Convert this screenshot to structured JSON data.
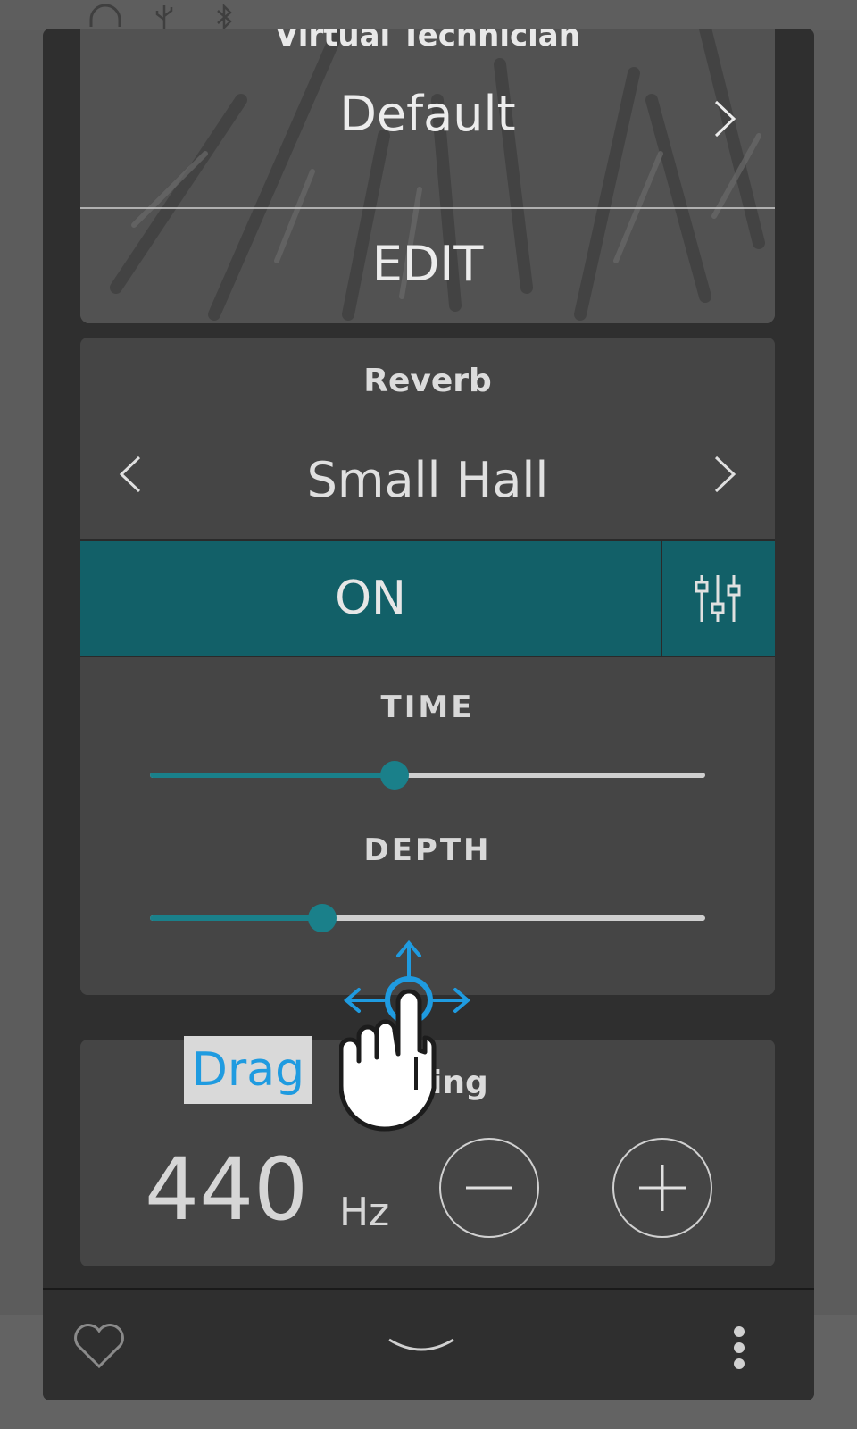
{
  "virtual_technician": {
    "title": "Virtual Technician",
    "value": "Default",
    "edit_label": "EDIT"
  },
  "reverb": {
    "title": "Reverb",
    "type": "Small Hall",
    "on_label": "ON",
    "params": [
      {
        "label": "TIME",
        "level": 0.44
      },
      {
        "label": "DEPTH",
        "level": 0.31
      }
    ]
  },
  "tuning": {
    "title": "Tuning",
    "value": "440",
    "unit": "Hz"
  },
  "gesture": {
    "label": "Drag"
  },
  "colors": {
    "accent": "#126068",
    "slider": "#1a808a",
    "panel": "#2f2f2f",
    "card": "#454545",
    "gesture": "#1f9be0"
  }
}
